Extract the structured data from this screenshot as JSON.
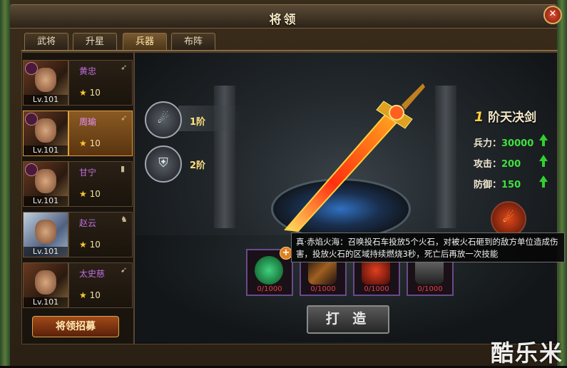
{
  "window": {
    "title": "将领",
    "close_glyph": "✕"
  },
  "tabs": [
    {
      "label": "武将",
      "active": false
    },
    {
      "label": "升星",
      "active": false
    },
    {
      "label": "兵器",
      "active": true
    },
    {
      "label": "布阵",
      "active": false
    }
  ],
  "generals": [
    {
      "name": "黄忠",
      "level": "Lv.101",
      "stars": "10",
      "class_icon": "bow-icon",
      "selected": false
    },
    {
      "name": "周瑜",
      "level": "Lv.101",
      "stars": "10",
      "class_icon": "bow-icon",
      "selected": true
    },
    {
      "name": "甘宁",
      "level": "Lv.101",
      "stars": "10",
      "class_icon": "shield-icon",
      "selected": false
    },
    {
      "name": "赵云",
      "level": "Lv.101",
      "stars": "10",
      "class_icon": "horse-icon",
      "selected": false
    },
    {
      "name": "太史慈",
      "level": "Lv.101",
      "stars": "10",
      "class_icon": "spear-icon",
      "selected": false
    }
  ],
  "recruit_button": "将领招募",
  "tiers": [
    {
      "label": "1阶",
      "icon": "sword-flame-icon"
    },
    {
      "label": "2阶",
      "icon": "shield-icon"
    }
  ],
  "weapon": {
    "tier_number": "1",
    "name": "阶天决剑",
    "stats": [
      {
        "label": "兵力：",
        "value": "30000"
      },
      {
        "label": "攻击：",
        "value": "200"
      },
      {
        "label": "防御：",
        "value": "150"
      }
    ]
  },
  "skill_tooltip": "真·赤焰火海：召唤投石车投放5个火石，对被火石砸到的敌方单位造成伤害，投放火石的区域持续燃烧3秒，死亡后再放一次技能",
  "materials": [
    {
      "icon": "green-gem-icon",
      "count": "0/1000"
    },
    {
      "icon": "bronze-sword-icon",
      "count": "0/1000"
    },
    {
      "icon": "red-ore-icon",
      "count": "0/1000"
    },
    {
      "icon": "iron-ingot-icon",
      "count": "0/1000"
    }
  ],
  "forge_button": "打 造",
  "watermark": "酷乐米",
  "colors": {
    "accent": "#e0a040",
    "stat_value": "#40e040",
    "material_count": "#e84040",
    "hero_name": "#c070e0"
  }
}
